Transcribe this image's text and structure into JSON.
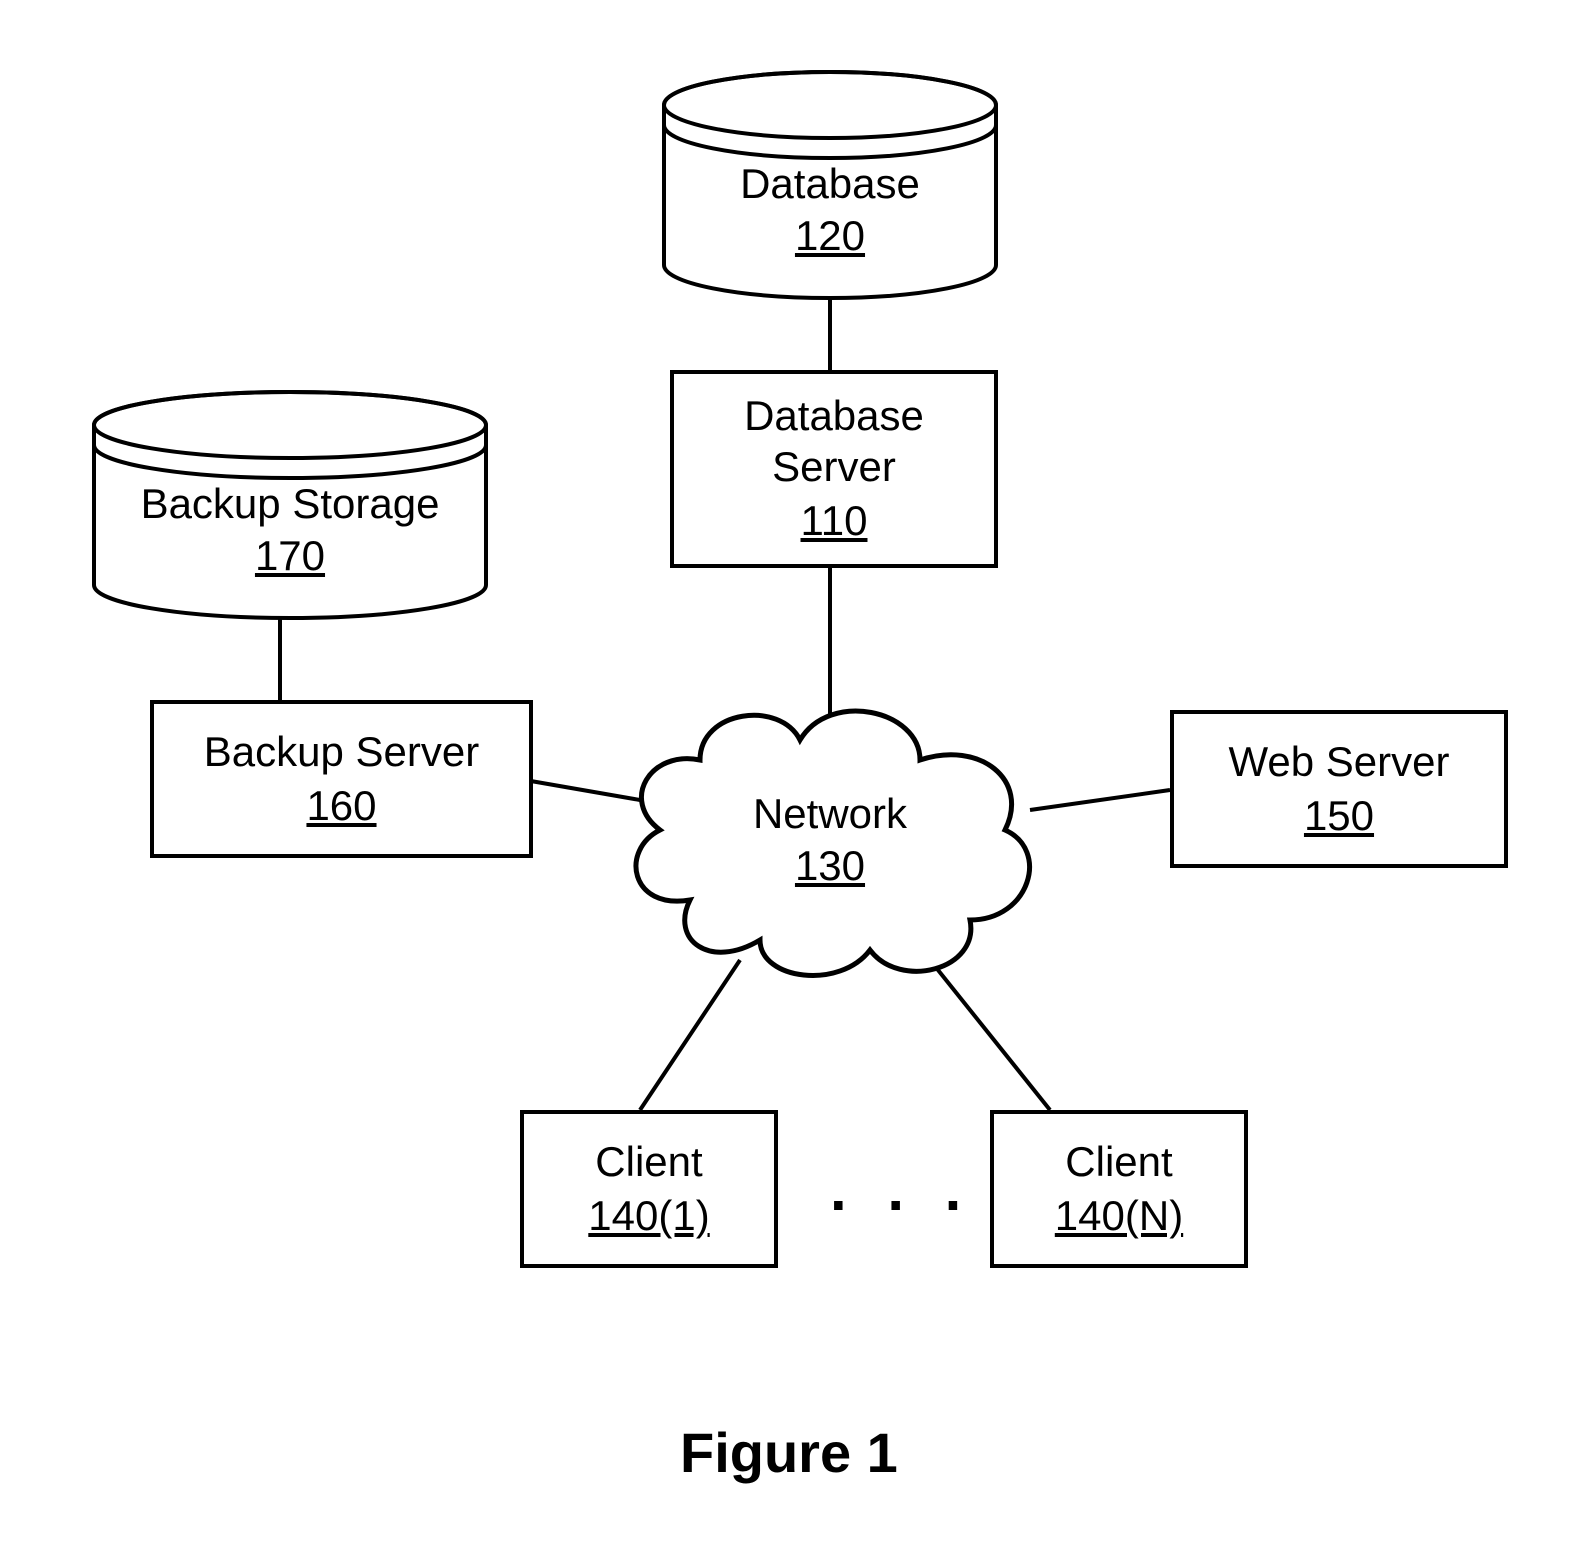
{
  "nodes": {
    "database": {
      "label": "Database",
      "ref": "120"
    },
    "database_server": {
      "label": "Database\nServer",
      "ref": "110"
    },
    "backup_storage": {
      "label": "Backup Storage",
      "ref": "170"
    },
    "backup_server": {
      "label": "Backup Server",
      "ref": "160"
    },
    "web_server": {
      "label": "Web Server",
      "ref": "150"
    },
    "network": {
      "label": "Network",
      "ref": "130"
    },
    "client_first": {
      "label": "Client",
      "ref": "140(1)"
    },
    "client_last": {
      "label": "Client",
      "ref": "140(N)"
    }
  },
  "dots": ". . .",
  "caption": "Figure 1"
}
